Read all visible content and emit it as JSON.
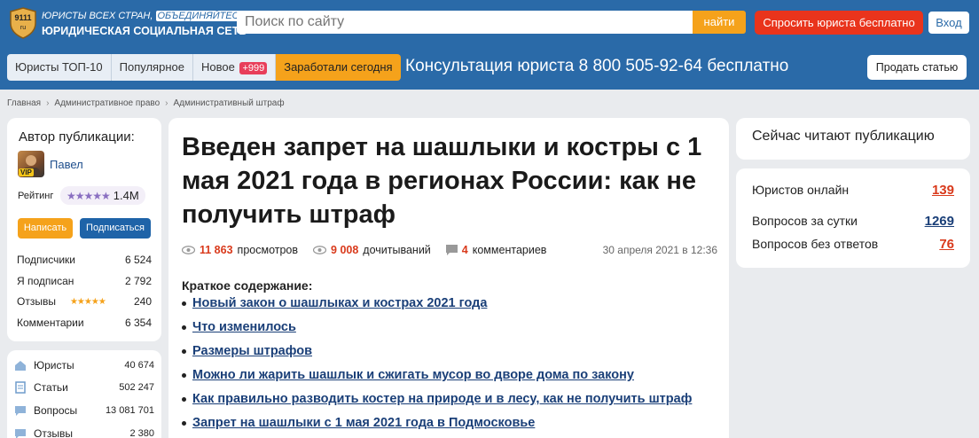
{
  "header": {
    "logo_badge": "9111",
    "logo_badge_sub": "ru",
    "tagline_1": "ЮРИСТЫ ВСЕХ СТРАН,",
    "tagline_2": "ОБЪЕДИНЯЙТЕСЬ!",
    "site_name": "ЮРИДИЧЕСКАЯ СОЦИАЛЬНАЯ СЕТЬ",
    "search_placeholder": "Поиск по сайту",
    "search_button": "найти",
    "ask_button": "Спросить юриста бесплатно",
    "login_button": "Вход"
  },
  "subnav": {
    "tabs": [
      "Юристы ТОП-10",
      "Популярное",
      "Новое",
      "Заработали сегодня"
    ],
    "new_badge": "+999",
    "consult_text": "Консультация юриста 8 800 505-92-64  бесплатно",
    "sell_button": "Продать статью"
  },
  "breadcrumb": [
    "Главная",
    "Административное право",
    "Административный штраф"
  ],
  "author": {
    "title": "Автор публикации:",
    "name": "Павел",
    "vip": "VIP",
    "rating_label": "Рейтинг",
    "rating_value": "1.4M",
    "write_button": "Написать",
    "subscribe_button": "Подписаться",
    "stats": [
      {
        "label": "Подписчики",
        "value": "6 524"
      },
      {
        "label": "Я подписан",
        "value": "2 792"
      },
      {
        "label": "Отзывы",
        "value": "240"
      },
      {
        "label": "Комментарии",
        "value": "6 354"
      }
    ]
  },
  "sidebar_nav": [
    {
      "label": "Юристы",
      "value": "40 674",
      "icon": "home-icon"
    },
    {
      "label": "Статьи",
      "value": "502 247",
      "icon": "article-icon"
    },
    {
      "label": "Вопросы",
      "value": "13 081 701",
      "icon": "question-icon"
    },
    {
      "label": "Отзывы",
      "value": "2 380",
      "icon": "review-icon"
    }
  ],
  "article": {
    "title": "Введен запрет на шашлыки и костры с 1 мая 2021 года в регионах России: как не получить штраф",
    "views_count": "11 863",
    "views_label": "просмотров",
    "reads_count": "9 008",
    "reads_label": "дочитываний",
    "comments_count": "4",
    "comments_label": "комментариев",
    "date": "30 апреля 2021 в 12:36",
    "toc_title": "Краткое содержание:",
    "toc": [
      "Новый закон о шашлыках и кострах 2021 года",
      "Что изменилось",
      "Размеры штрафов",
      "Можно ли жарить шашлык и сжигать мусор во дворе дома по закону",
      "Как правильно разводить костер на природе и в лесу, как не получить штраф",
      "Запрет на шашлыки с 1 мая 2021 года в Подмосковье"
    ]
  },
  "right": {
    "reading_now": "Сейчас читают публикацию",
    "stats": [
      {
        "label": "Юристов онлайн",
        "value": "139",
        "color": "#d93a1c"
      },
      {
        "label": "Вопросов за сутки",
        "value": "1269",
        "color": "#1a3f78"
      },
      {
        "label": "Вопросов без ответов",
        "value": "76",
        "color": "#d93a1c"
      }
    ]
  }
}
